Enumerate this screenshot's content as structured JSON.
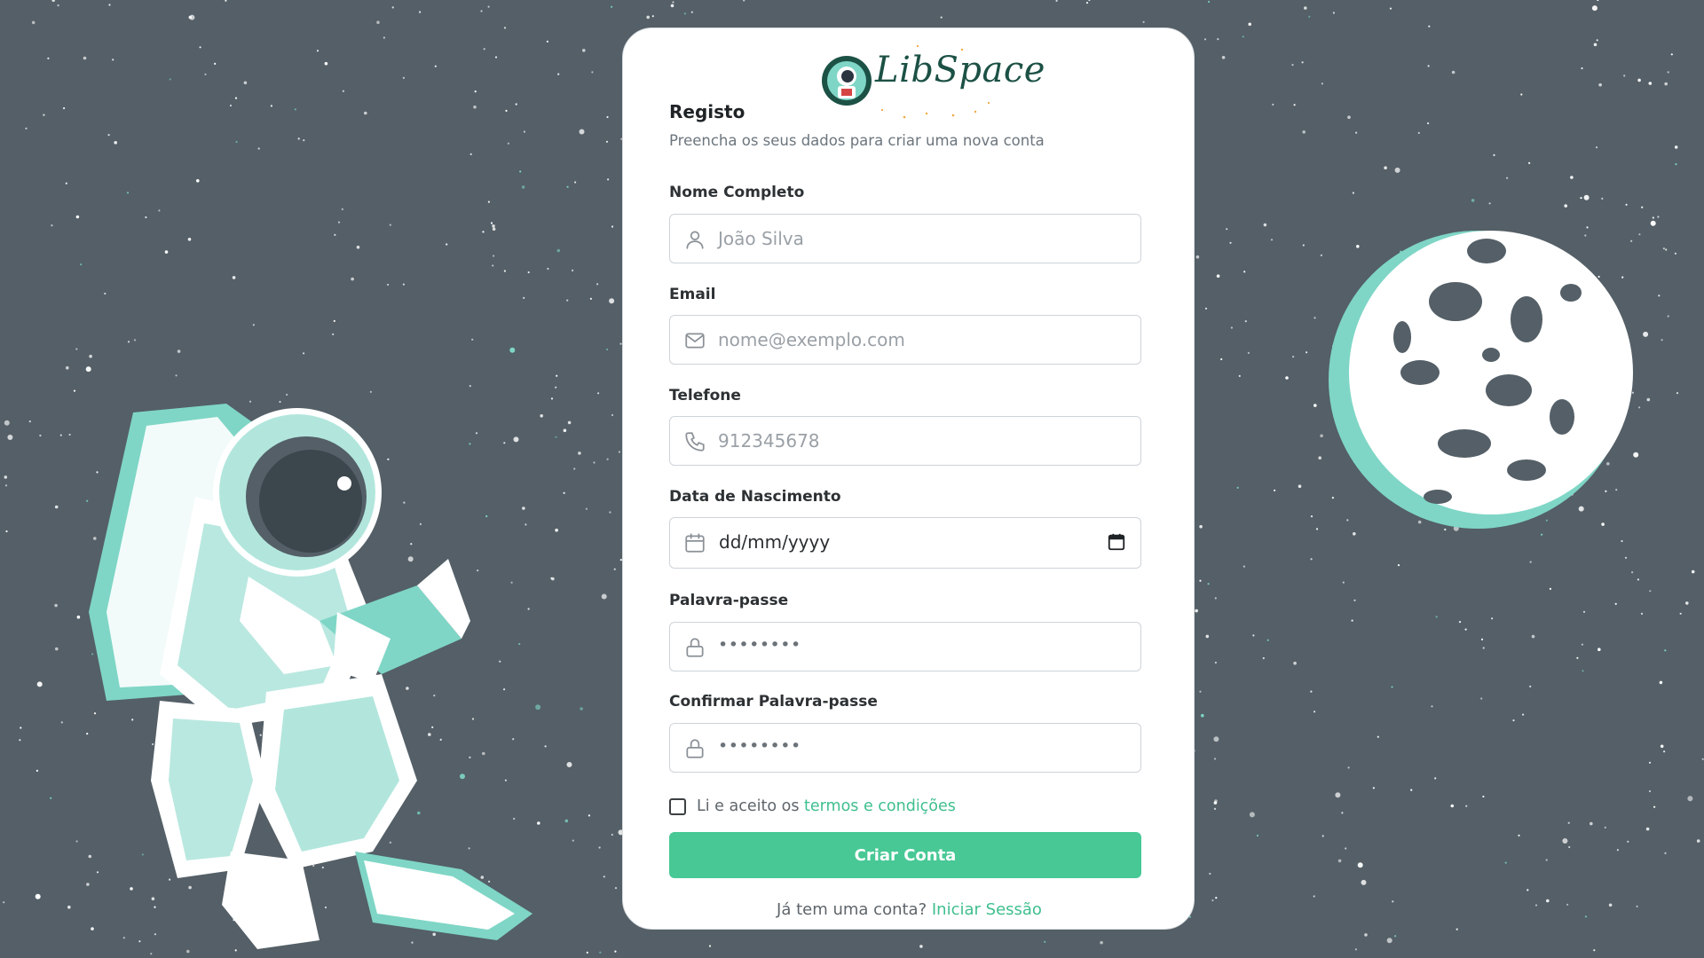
{
  "brand": {
    "name": "LibSpace"
  },
  "form": {
    "title": "Registo",
    "subtitle": "Preencha os seus dados para criar uma nova conta",
    "name": {
      "label": "Nome Completo",
      "placeholder": "João Silva",
      "icon": "user-icon"
    },
    "email": {
      "label": "Email",
      "placeholder": "nome@exemplo.com",
      "icon": "mail-icon"
    },
    "phone": {
      "label": "Telefone",
      "placeholder": "912345678",
      "icon": "phone-icon"
    },
    "birthdate": {
      "label": "Data de Nascimento",
      "value": "dd/mm/yyyy",
      "icon": "calendar-icon"
    },
    "password": {
      "label": "Palavra-passe",
      "value": "••••••••",
      "icon": "lock-icon"
    },
    "confirm_password": {
      "label": "Confirmar Palavra-passe",
      "value": "••••••••",
      "icon": "lock-icon"
    },
    "terms": {
      "prefix": "Li e aceito os",
      "link": "termos e condições",
      "checked": false
    },
    "submit_label": "Criar Conta",
    "login_prompt": "Já tem uma conta?",
    "login_link": "Iniciar Sessão"
  },
  "colors": {
    "background": "#545f67",
    "accent": "#47c895",
    "link": "#3fbf8e",
    "illustration": "#7fd6c6"
  }
}
